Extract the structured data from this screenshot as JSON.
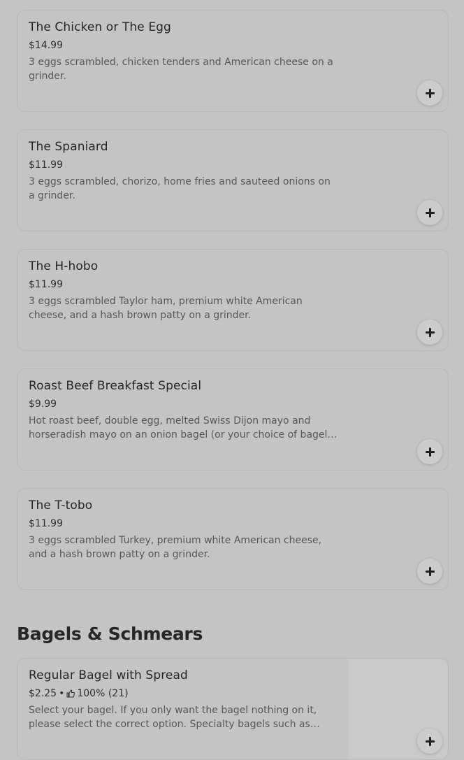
{
  "items": [
    {
      "name": "The Chicken or The Egg",
      "price": "$14.99",
      "description": "3 eggs scrambled, chicken tenders and American cheese on a grinder."
    },
    {
      "name": "The Spaniard",
      "price": "$11.99",
      "description": "3 eggs scrambled, chorizo, home fries and sauteed onions on a grinder."
    },
    {
      "name": "The H-hobo",
      "price": "$11.99",
      "description": "3 eggs scrambled Taylor ham, premium white American cheese, and a hash brown patty on a grinder."
    },
    {
      "name": "Roast Beef Breakfast Special",
      "price": "$9.99",
      "description": "Hot roast beef, double egg, melted Swiss Dijon mayo and horseradish mayo on an onion bagel (or your choice of bagel. Please specify in…"
    },
    {
      "name": "The T-tobo",
      "price": "$11.99",
      "description": "3 eggs scrambled Turkey, premium white American cheese, and a hash brown patty on a grinder."
    }
  ],
  "section": {
    "title": "Bagels & Schmears"
  },
  "bagel_item": {
    "name": "Regular Bagel with Spread",
    "price": "$2.25",
    "separator": "•",
    "rating": "100% (21)",
    "description": "Select your bagel. If you only want the bagel nothing on it, please select the correct option. Specialty bagels such as French toast,…"
  },
  "icons": {
    "add": "plus-icon",
    "rating": "thumbs-up-icon"
  },
  "colors": {
    "background": "#c4c4c4",
    "text_primary": "#262626",
    "text_secondary": "#575757"
  }
}
